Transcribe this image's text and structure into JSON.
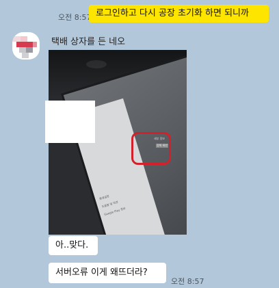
{
  "messages": {
    "m1": {
      "time": "오전 8:57",
      "text": "로그인하고 다시 공장 초기화 하면 되니까"
    },
    "sender_name": "택배 상자를 든 네오",
    "m3": {
      "text": "아..맞다."
    },
    "m4": {
      "text": "서버오류 이게 왜뜨더라?",
      "time": "오전 8:57"
    }
  },
  "photo": {
    "menu_items": [
      "환경설정",
      "도움말 및 의견",
      "Google Play 정보"
    ],
    "box_texts": [
      "세부 정보",
      "정책 위반"
    ]
  },
  "colors": {
    "chat_background": "#b2c7da",
    "my_bubble": "#fee500",
    "their_bubble": "#ffffff",
    "highlight_box": "#d4202a"
  }
}
